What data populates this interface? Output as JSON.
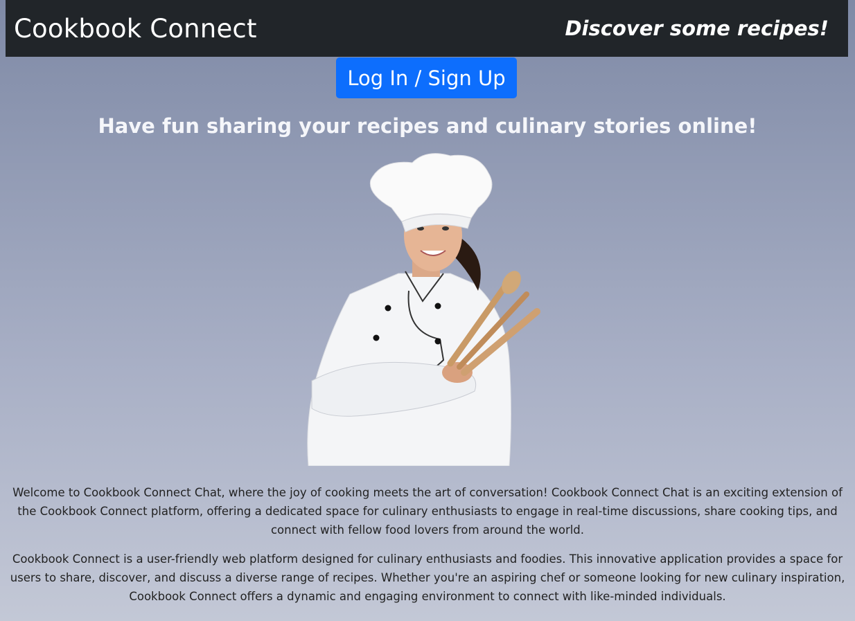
{
  "navbar": {
    "brand": "Cookbook Connect",
    "tagline": "Discover some recipes!"
  },
  "auth": {
    "login_label": "Log In / Sign Up"
  },
  "main": {
    "headline": "Have fun sharing your recipes and culinary stories online!",
    "paragraphs": [
      "Welcome to Cookbook Connect Chat, where the joy of cooking meets the art of conversation! Cookbook Connect Chat is an exciting extension of the Cookbook Connect platform, offering a dedicated space for culinary enthusiasts to engage in real-time discussions, share cooking tips, and connect with fellow food lovers from around the world.",
      "Cookbook Connect is a user-friendly web platform designed for culinary enthusiasts and foodies. This innovative application provides a space for users to share, discover, and discuss a diverse range of recipes. Whether you're an aspiring chef or someone looking for new culinary inspiration, Cookbook Connect offers a dynamic and engaging environment to connect with like-minded individuals."
    ]
  },
  "colors": {
    "navbar_bg": "#212529",
    "primary_button": "#0d6efd"
  }
}
